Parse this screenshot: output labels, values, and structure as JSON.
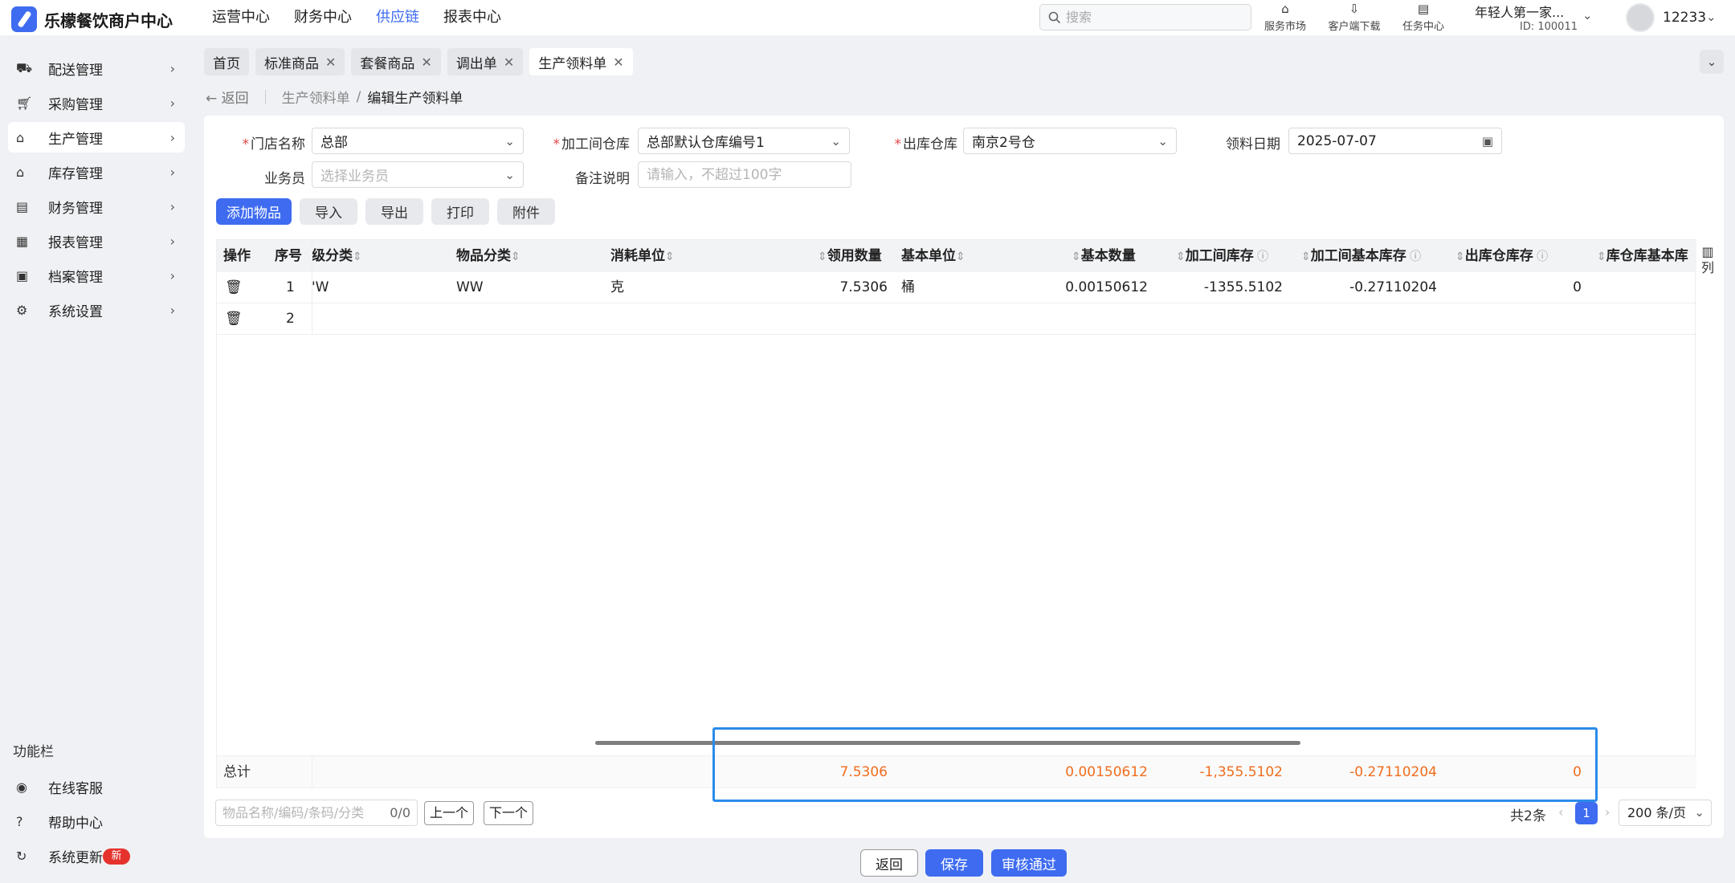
{
  "app": {
    "title": "乐檬餐饮商户中心"
  },
  "topnav": {
    "items": [
      "运营中心",
      "财务中心",
      "供应链",
      "报表中心"
    ],
    "active_index": 2
  },
  "search": {
    "placeholder": "搜索"
  },
  "header_tools": [
    {
      "label": "服务市场",
      "icon": "shop-icon"
    },
    {
      "label": "客户端下载",
      "icon": "download-icon"
    },
    {
      "label": "任务中心",
      "icon": "clipboard-icon"
    }
  ],
  "account": {
    "name": "年轻人第一家...",
    "id": "ID: 100011"
  },
  "user": {
    "name": "12233"
  },
  "sidebar": {
    "items": [
      {
        "label": "配送管理",
        "icon": "truck-icon"
      },
      {
        "label": "采购管理",
        "icon": "cart-icon"
      },
      {
        "label": "生产管理",
        "icon": "factory-icon",
        "active": true
      },
      {
        "label": "库存管理",
        "icon": "warehouse-icon"
      },
      {
        "label": "财务管理",
        "icon": "finance-icon"
      },
      {
        "label": "报表管理",
        "icon": "report-icon"
      },
      {
        "label": "档案管理",
        "icon": "archive-icon"
      },
      {
        "label": "系统设置",
        "icon": "gear-icon"
      }
    ],
    "section_title": "功能栏",
    "bottom_items": [
      {
        "label": "在线客服",
        "icon": "headset-icon"
      },
      {
        "label": "帮助中心",
        "icon": "help-icon"
      },
      {
        "label": "系统更新",
        "icon": "refresh-icon",
        "badge": "新"
      }
    ]
  },
  "tabs": [
    {
      "label": "首页",
      "closable": false
    },
    {
      "label": "标准商品",
      "closable": true
    },
    {
      "label": "套餐商品",
      "closable": true
    },
    {
      "label": "调出单",
      "closable": true
    },
    {
      "label": "生产领料单",
      "closable": true,
      "active": true
    }
  ],
  "breadcrumb": {
    "back": "返回",
    "parent": "生产领料单",
    "separator": "/",
    "current": "编辑生产领料单"
  },
  "form": {
    "store": {
      "label": "门店名称",
      "value": "总部",
      "required": true
    },
    "workshop_warehouse": {
      "label": "加工间仓库",
      "value": "总部默认仓库编号1",
      "required": true
    },
    "out_warehouse": {
      "label": "出库仓库",
      "value": "南京2号仓",
      "required": true
    },
    "pick_date": {
      "label": "领料日期",
      "value": "2025-07-07"
    },
    "salesman": {
      "label": "业务员",
      "placeholder": "选择业务员"
    },
    "remark": {
      "label": "备注说明",
      "placeholder": "请输入，不超过100字"
    }
  },
  "actions": {
    "add": "添加物品",
    "import": "导入",
    "export": "导出",
    "print": "打印",
    "attach": "附件"
  },
  "table": {
    "headers": {
      "op": "操作",
      "seq": "序号",
      "category_level": "级分类",
      "item_category": "物品分类",
      "unit": "消耗单位",
      "qty": "领用数量",
      "base_unit": "基本单位",
      "base_qty": "基本数量",
      "ws_stock": "加工间库存",
      "ws_base_stock": "加工间基本库存",
      "out_stock": "出库仓库存",
      "out_base_stock": "库仓库基本库"
    },
    "rows": [
      {
        "seq": "1",
        "category_level": "'W",
        "item_category": "WW",
        "unit": "克",
        "qty": "7.5306",
        "base_unit": "桶",
        "base_qty": "0.00150612",
        "ws_stock": "-1355.5102",
        "ws_base_stock": "-0.27110204",
        "out_stock": "0",
        "out_base_stock": ""
      },
      {
        "seq": "2",
        "category_level": "",
        "item_category": "",
        "unit": "",
        "qty": "",
        "base_unit": "",
        "base_qty": "",
        "ws_stock": "",
        "ws_base_stock": "",
        "out_stock": "",
        "out_base_stock": ""
      }
    ],
    "footer": {
      "label": "总计",
      "qty": "7.5306",
      "base_qty": "0.00150612",
      "ws_stock": "-1,355.5102",
      "ws_base_stock": "-0.27110204",
      "out_stock": "0"
    },
    "column_button": "列"
  },
  "finder": {
    "placeholder": "物品名称/编码/条码/分类",
    "count": "0/0",
    "prev": "上一个",
    "next": "下一个"
  },
  "pagination": {
    "total": "共2条",
    "current": "1",
    "page_size": "200 条/页"
  },
  "bottom_actions": {
    "back": "返回",
    "save": "保存",
    "approve": "审核通过"
  },
  "colors": {
    "primary": "#3e6bf0",
    "number": "#f06d1d",
    "highlight": "#2b8bea",
    "badge": "#e5322d"
  }
}
